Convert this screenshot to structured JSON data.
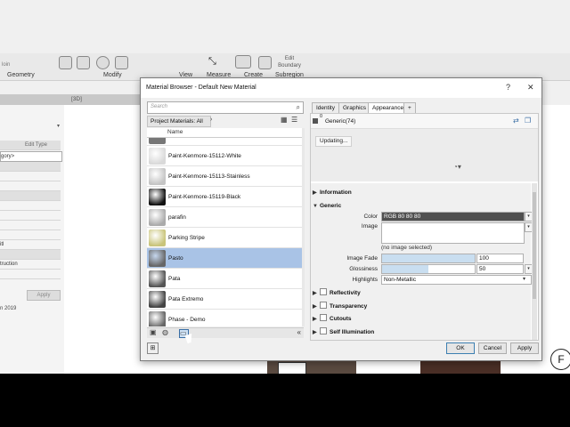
{
  "ribbon": {
    "groups": [
      "Geometry",
      "Modify",
      "View",
      "Measure",
      "Create",
      "Subregion"
    ],
    "edit_boundary": "Edit Boundary",
    "partial_left": "loin"
  },
  "view_tab": "[3D]",
  "left_panel": {
    "edit_type": "Edit Type",
    "rows": [
      "gory>",
      "truction",
      "itl"
    ],
    "apply": "Apply",
    "footer": "n 2019"
  },
  "dialog": {
    "title": "Material Browser - Default New Material",
    "help": "?",
    "close": "✕",
    "search_placeholder": "Search",
    "project_materials": "Project Materials: All",
    "column_name": "Name",
    "materials": [
      {
        "name": "Paint-Kenmore-15112-White",
        "swatch": "#d9d9d9"
      },
      {
        "name": "Paint-Kenmore-15113-Stainless",
        "swatch": "#c4c4c4"
      },
      {
        "name": "Paint-Kenmore-15119-Black",
        "swatch": "#111111"
      },
      {
        "name": "parafin",
        "swatch": "#aaaaaa"
      },
      {
        "name": "Parking Stripe",
        "swatch": "#c9c47a"
      },
      {
        "name": "Pasto",
        "swatch": "#666666",
        "selected": true
      },
      {
        "name": "Pata",
        "swatch": "#555555"
      },
      {
        "name": "Pata Extremo",
        "swatch": "#444444"
      },
      {
        "name": "Phase - Demo",
        "swatch": "#666666"
      }
    ],
    "tabs": [
      "Identity",
      "Graphics",
      "Appearance",
      "+"
    ],
    "active_tab": "Appearance",
    "asset_count": "0",
    "asset_name": "Generic(74)",
    "updating": "Updating...",
    "sections": {
      "information": "Information",
      "generic": "Generic",
      "reflectivity": "Reflectivity",
      "transparency": "Transparency",
      "cutouts": "Cutouts",
      "self_illumination": "Self Illumination"
    },
    "properties": {
      "color_label": "Color",
      "color_value": "RGB 80 80 80",
      "image_label": "Image",
      "no_image": "(no image selected)",
      "image_fade_label": "Image Fade",
      "image_fade_value": "100",
      "image_fade_fraction": 1.0,
      "glossiness_label": "Glossiness",
      "glossiness_value": "50",
      "glossiness_fraction": 0.5,
      "highlights_label": "Highlights",
      "highlights_value": "Non-Metallic"
    },
    "buttons": {
      "ok": "OK",
      "cancel": "Cancel",
      "apply": "Apply"
    }
  },
  "corner_badge": "F"
}
